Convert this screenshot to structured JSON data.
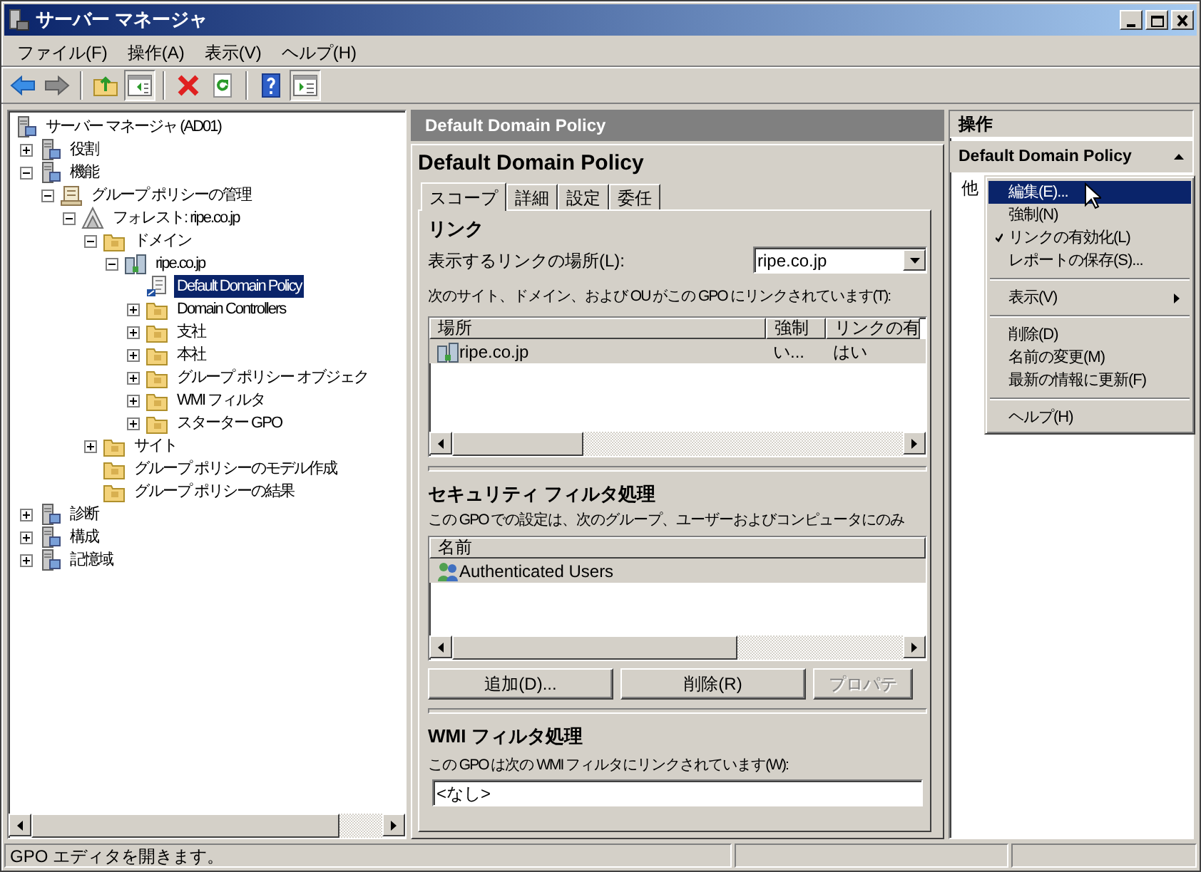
{
  "window": {
    "title": "サーバー マネージャ"
  },
  "menu_bar": [
    "ファイル(F)",
    "操作(A)",
    "表示(V)",
    "ヘルプ(H)"
  ],
  "toolbar": [
    {
      "kind": "back",
      "pressed": false
    },
    {
      "kind": "forward",
      "pressed": false
    },
    {
      "kind": "separator"
    },
    {
      "kind": "up",
      "pressed": false
    },
    {
      "kind": "tree",
      "pressed": true
    },
    {
      "kind": "separator"
    },
    {
      "kind": "delete",
      "pressed": false
    },
    {
      "kind": "refresh",
      "pressed": false
    },
    {
      "kind": "separator"
    },
    {
      "kind": "help",
      "pressed": false
    },
    {
      "kind": "actionpane",
      "pressed": true
    }
  ],
  "tree": [
    {
      "label": "サーバー マネージャ (AD01)",
      "kind": "server",
      "selected": false,
      "children": [
        {
          "label": "役割",
          "kind": "server",
          "expanded": false,
          "selected": false
        },
        {
          "label": "機能",
          "kind": "server",
          "expanded": true,
          "selected": false,
          "children": [
            {
              "label": "グループ ポリシーの管理",
              "kind": "scroll",
              "expanded": true,
              "selected": false,
              "children": [
                {
                  "label": "フォレスト: ripe.co.jp",
                  "kind": "forest",
                  "expanded": true,
                  "selected": false,
                  "children": [
                    {
                      "label": "ドメイン",
                      "kind": "folder",
                      "expanded": true,
                      "selected": false,
                      "children": [
                        {
                          "label": "ripe.co.jp",
                          "kind": "domain",
                          "expanded": true,
                          "selected": false,
                          "children": [
                            {
                              "label": "Default Domain Policy",
                              "kind": "policy",
                              "selected": true
                            },
                            {
                              "label": "Domain Controllers",
                              "kind": "folder",
                              "expanded": false,
                              "selected": false
                            },
                            {
                              "label": "支社",
                              "kind": "folder",
                              "expanded": false,
                              "selected": false
                            },
                            {
                              "label": "本社",
                              "kind": "folder",
                              "expanded": false,
                              "selected": false
                            },
                            {
                              "label": "グループ ポリシー オブジェク",
                              "kind": "folder",
                              "expanded": false,
                              "selected": false
                            },
                            {
                              "label": "WMI フィルタ",
                              "kind": "folder",
                              "expanded": false,
                              "selected": false
                            },
                            {
                              "label": "スターター GPO",
                              "kind": "folder",
                              "expanded": false,
                              "selected": false
                            }
                          ]
                        }
                      ]
                    },
                    {
                      "label": "サイト",
                      "kind": "folder",
                      "expanded": false,
                      "selected": false
                    },
                    {
                      "label": "グループ ポリシーのモデル作成",
                      "kind": "folder",
                      "selected": false
                    },
                    {
                      "label": "グループ ポリシーの結果",
                      "kind": "folder",
                      "selected": false
                    }
                  ]
                }
              ]
            }
          ]
        },
        {
          "label": "診断",
          "kind": "server",
          "expanded": false,
          "selected": false
        },
        {
          "label": "構成",
          "kind": "server",
          "expanded": false,
          "selected": false
        },
        {
          "label": "記憶域",
          "kind": "server",
          "expanded": false,
          "selected": false
        }
      ]
    }
  ],
  "details": {
    "header": "Default Domain Policy",
    "title": "Default Domain Policy",
    "tabs": [
      {
        "label": "スコープ",
        "selected": true
      },
      {
        "label": "詳細",
        "selected": false
      },
      {
        "label": "設定",
        "selected": false
      },
      {
        "label": "委任",
        "selected": false
      }
    ],
    "links": {
      "heading": "リンク",
      "location_label": "表示するリンクの場所(L):",
      "location_value": "ripe.co.jp",
      "description": "次のサイト、ドメイン、および OU がこの GPO にリンクされています(T):",
      "columns": [
        "場所",
        "強制",
        "リンクの有"
      ],
      "rows": [
        {
          "cells": [
            "ripe.co.jp",
            "い...",
            "はい"
          ],
          "selected": true
        }
      ]
    },
    "security": {
      "heading": "セキュリティ フィルタ処理",
      "description": "この GPO での設定は、次のグループ、ユーザーおよびコンピュータにのみ",
      "columns": [
        "名前"
      ],
      "rows": [
        {
          "cells": [
            "Authenticated Users"
          ],
          "selected": true
        }
      ],
      "buttons": [
        {
          "label": "追加(D)...",
          "disabled": false
        },
        {
          "label": "削除(R)",
          "disabled": false
        },
        {
          "label": "プロパテ",
          "disabled": true
        }
      ]
    },
    "wmi": {
      "heading": "WMI フィルタ処理",
      "description": "この GPO は次の WMI フィルタにリンクされています(W):",
      "value": "<なし>"
    }
  },
  "actions": {
    "header": "操作",
    "section": "Default Domain Policy",
    "item": "他"
  },
  "context_menu": [
    {
      "label": "編集(E)...",
      "selected": true,
      "checked": false,
      "submenu": false
    },
    {
      "label": "強制(N)",
      "selected": false,
      "checked": false,
      "submenu": false
    },
    {
      "label": "リンクの有効化(L)",
      "selected": false,
      "checked": true,
      "submenu": false
    },
    {
      "label": "レポートの保存(S)...",
      "selected": false,
      "checked": false,
      "submenu": false
    },
    {
      "kind": "separator"
    },
    {
      "label": "表示(V)",
      "selected": false,
      "checked": false,
      "submenu": true
    },
    {
      "kind": "separator"
    },
    {
      "label": "削除(D)",
      "selected": false,
      "checked": false,
      "submenu": false
    },
    {
      "label": "名前の変更(M)",
      "selected": false,
      "checked": false,
      "submenu": false
    },
    {
      "label": "最新の情報に更新(F)",
      "selected": false,
      "checked": false,
      "submenu": false
    },
    {
      "kind": "separator"
    },
    {
      "label": "ヘルプ(H)",
      "selected": false,
      "checked": false,
      "submenu": false
    }
  ],
  "status_bar": [
    "GPO エディタを開きます。"
  ]
}
